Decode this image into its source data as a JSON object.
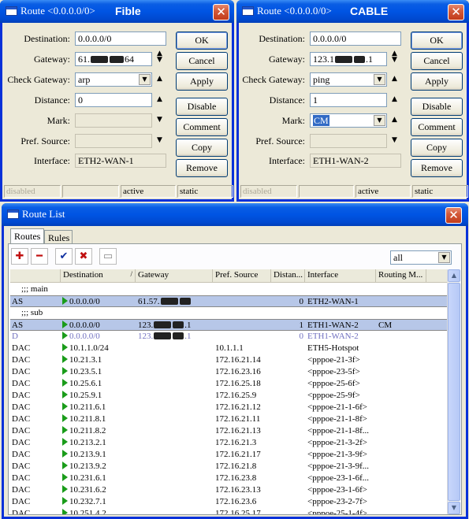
{
  "dialogs": [
    {
      "title_prefix": "Route <0.0.0.0/0>",
      "title_name": "Fible",
      "fields": {
        "destination": "0.0.0.0/0",
        "gateway_prefix": "61.",
        "gateway_suffix": "64",
        "check_gateway": "arp",
        "distance": "0",
        "mark": "",
        "pref_source": "",
        "interface": "ETH2-WAN-1"
      },
      "status": [
        "disabled",
        "",
        "active",
        "static"
      ]
    },
    {
      "title_prefix": "Route <0.0.0.0/0>",
      "title_name": "CABLE",
      "fields": {
        "destination": "0.0.0.0/0",
        "gateway_prefix": "123.1",
        "gateway_suffix": ".1",
        "check_gateway": "ping",
        "distance": "1",
        "mark": "CM",
        "pref_source": "",
        "interface": "ETH1-WAN-2"
      },
      "status": [
        "disabled",
        "",
        "active",
        "static"
      ]
    }
  ],
  "labels": {
    "destination": "Destination:",
    "gateway": "Gateway:",
    "check_gateway": "Check Gateway:",
    "distance": "Distance:",
    "mark": "Mark:",
    "pref_source": "Pref. Source:",
    "interface": "Interface:"
  },
  "buttons": {
    "ok": "OK",
    "cancel": "Cancel",
    "apply": "Apply",
    "disable": "Disable",
    "comment": "Comment",
    "copy": "Copy",
    "remove": "Remove"
  },
  "route_list": {
    "title": "Route List",
    "tabs": [
      "Routes",
      "Rules"
    ],
    "filter": "all",
    "columns": [
      "",
      "Destination",
      "Gateway",
      "Pref. Source",
      "Distan...",
      "Interface",
      "Routing M..."
    ],
    "comment_main": ";;; main",
    "comment_sub": ";;; sub",
    "rows": [
      {
        "flag": "AS",
        "dst": "0.0.0.0/0",
        "gw": "61.57.",
        "gw2": "",
        "src": "",
        "dist": "0",
        "iface": "ETH2-WAN-1",
        "mark": ""
      },
      {
        "flag": "AS",
        "dst": "0.0.0.0/0",
        "gw": "123.",
        "gw2": ".1",
        "src": "",
        "dist": "1",
        "iface": "ETH1-WAN-2",
        "mark": "CM"
      },
      {
        "flag": "D",
        "dst": "0.0.0.0/0",
        "gw": "123.",
        "gw2": ".1",
        "src": "",
        "dist": "0",
        "iface": "ETH1-WAN-2",
        "mark": ""
      },
      {
        "flag": "DAC",
        "dst": "10.1.1.0/24",
        "gw": "",
        "gw2": "",
        "src": "10.1.1.1",
        "dist": "",
        "iface": "ETH5-Hotspot",
        "mark": ""
      },
      {
        "flag": "DAC",
        "dst": "10.21.3.1",
        "gw": "",
        "gw2": "",
        "src": "172.16.21.14",
        "dist": "",
        "iface": "<pppoe-21-3f>",
        "mark": ""
      },
      {
        "flag": "DAC",
        "dst": "10.23.5.1",
        "gw": "",
        "gw2": "",
        "src": "172.16.23.16",
        "dist": "",
        "iface": "<pppoe-23-5f>",
        "mark": ""
      },
      {
        "flag": "DAC",
        "dst": "10.25.6.1",
        "gw": "",
        "gw2": "",
        "src": "172.16.25.18",
        "dist": "",
        "iface": "<pppoe-25-6f>",
        "mark": ""
      },
      {
        "flag": "DAC",
        "dst": "10.25.9.1",
        "gw": "",
        "gw2": "",
        "src": "172.16.25.9",
        "dist": "",
        "iface": "<pppoe-25-9f>",
        "mark": ""
      },
      {
        "flag": "DAC",
        "dst": "10.211.6.1",
        "gw": "",
        "gw2": "",
        "src": "172.16.21.12",
        "dist": "",
        "iface": "<pppoe-21-1-6f>",
        "mark": ""
      },
      {
        "flag": "DAC",
        "dst": "10.211.8.1",
        "gw": "",
        "gw2": "",
        "src": "172.16.21.11",
        "dist": "",
        "iface": "<pppoe-21-1-8f>",
        "mark": ""
      },
      {
        "flag": "DAC",
        "dst": "10.211.8.2",
        "gw": "",
        "gw2": "",
        "src": "172.16.21.13",
        "dist": "",
        "iface": "<pppoe-21-1-8f...",
        "mark": ""
      },
      {
        "flag": "DAC",
        "dst": "10.213.2.1",
        "gw": "",
        "gw2": "",
        "src": "172.16.21.3",
        "dist": "",
        "iface": "<pppoe-21-3-2f>",
        "mark": ""
      },
      {
        "flag": "DAC",
        "dst": "10.213.9.1",
        "gw": "",
        "gw2": "",
        "src": "172.16.21.17",
        "dist": "",
        "iface": "<pppoe-21-3-9f>",
        "mark": ""
      },
      {
        "flag": "DAC",
        "dst": "10.213.9.2",
        "gw": "",
        "gw2": "",
        "src": "172.16.21.8",
        "dist": "",
        "iface": "<pppoe-21-3-9f...",
        "mark": ""
      },
      {
        "flag": "DAC",
        "dst": "10.231.6.1",
        "gw": "",
        "gw2": "",
        "src": "172.16.23.8",
        "dist": "",
        "iface": "<pppoe-23-1-6f...",
        "mark": ""
      },
      {
        "flag": "DAC",
        "dst": "10.231.6.2",
        "gw": "",
        "gw2": "",
        "src": "172.16.23.13",
        "dist": "",
        "iface": "<pppoe-23-1-6f>",
        "mark": ""
      },
      {
        "flag": "DAC",
        "dst": "10.232.7.1",
        "gw": "",
        "gw2": "",
        "src": "172.16.23.6",
        "dist": "",
        "iface": "<pppoe-23-2-7f>",
        "mark": ""
      },
      {
        "flag": "DAC",
        "dst": "10.251.4.2",
        "gw": "",
        "gw2": "",
        "src": "172.16.25.17",
        "dist": "",
        "iface": "<pppoe-25-1-4f>",
        "mark": ""
      }
    ]
  },
  "icons": [
    "add-icon",
    "remove-icon",
    "enable-icon",
    "disable-icon",
    "comment-icon",
    "close-icon",
    "window-icon",
    "route-active-icon"
  ],
  "colors": {
    "titlebar": "#0054e3",
    "selected_row": "#b7c7e8",
    "disabled_text": "#7070c0",
    "active_flag": "#1a9c1a"
  }
}
